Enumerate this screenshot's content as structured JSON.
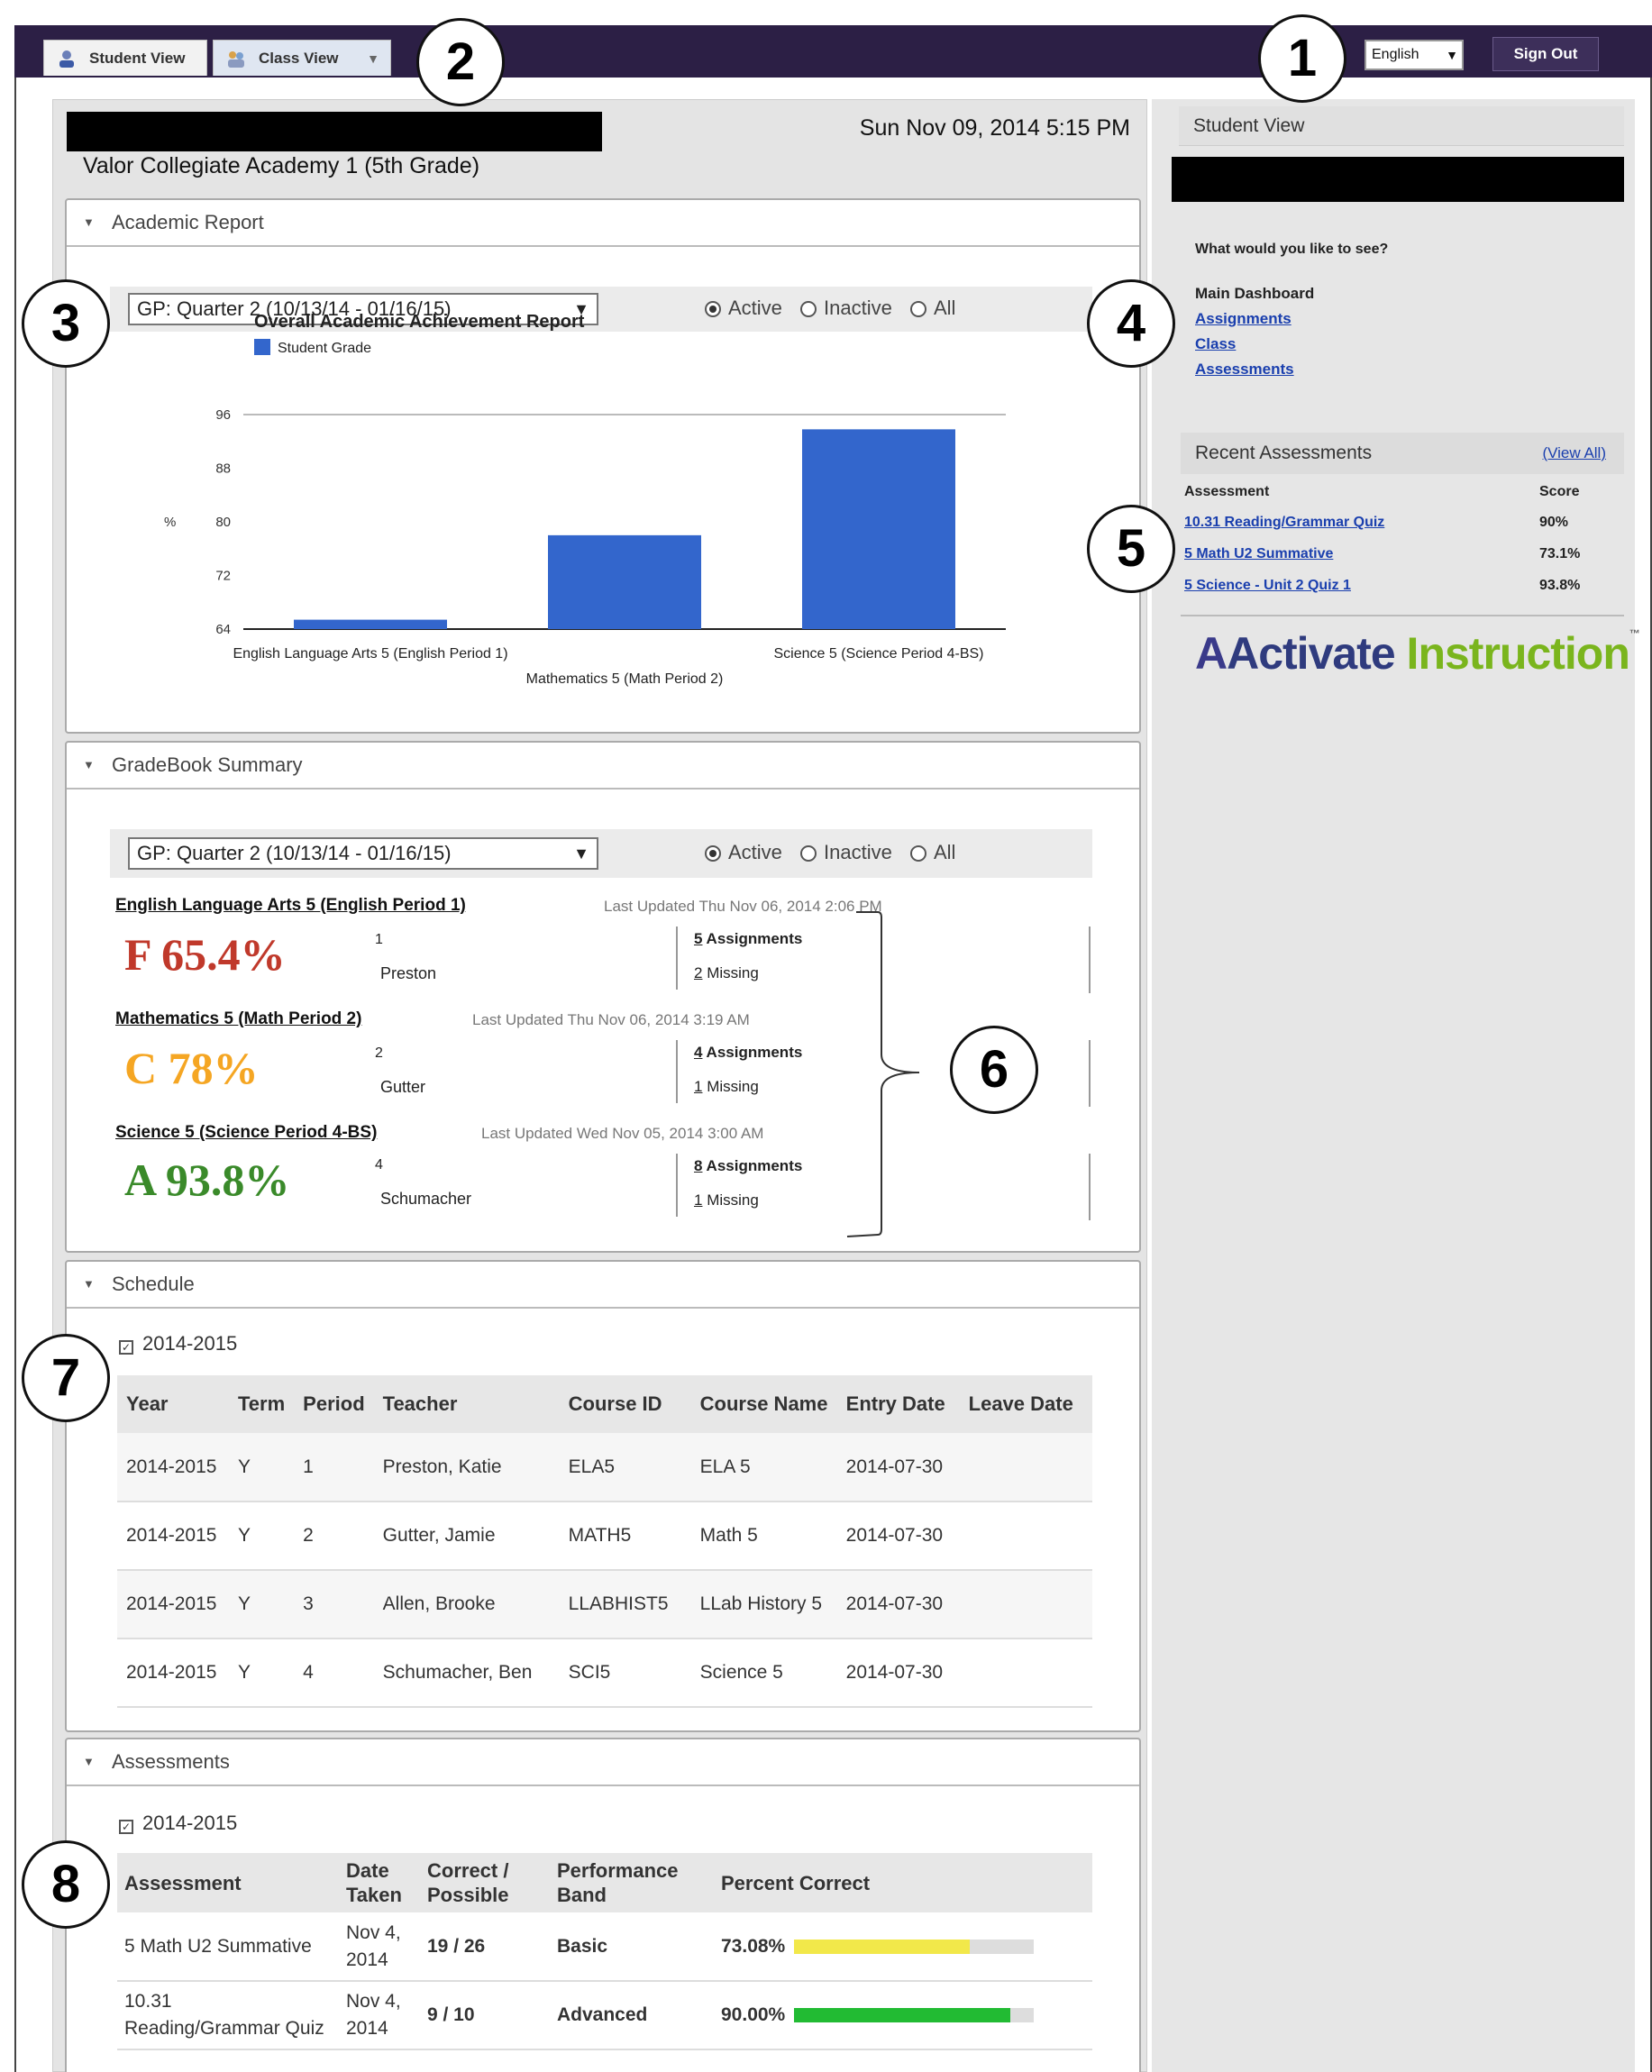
{
  "topbar": {
    "tabs": [
      {
        "label": "Student View"
      },
      {
        "label": "Class View"
      }
    ],
    "language": "English",
    "sign_out": "Sign Out"
  },
  "callouts": [
    "1",
    "2",
    "3",
    "4",
    "5",
    "6",
    "7",
    "8"
  ],
  "header": {
    "datetime": "Sun Nov 09, 2014 5:15 PM",
    "school": "Valor Collegiate Academy 1 (5th Grade)"
  },
  "academic_report": {
    "title": "Academic Report",
    "grading_period": "GP: Quarter 2 (10/13/14 - 01/16/15)",
    "filters": [
      "Active",
      "Inactive",
      "All"
    ],
    "selected_filter": "Active"
  },
  "chart_data": {
    "type": "bar",
    "title": "Overall Academic Achievement Report",
    "legend": [
      "Student Grade"
    ],
    "ylabel": "%",
    "ylim": [
      64,
      96
    ],
    "yticks": [
      64,
      72,
      80,
      88,
      96
    ],
    "categories": [
      "English Language Arts 5 (English Period 1)",
      "Mathematics 5 (Math Period 2)",
      "Science 5 (Science Period 4-BS)"
    ],
    "series": [
      {
        "name": "Student Grade",
        "values": [
          65.4,
          78,
          93.8
        ]
      }
    ],
    "bar_color": "#3366cc",
    "grid": false
  },
  "gradebook": {
    "title": "GradeBook Summary",
    "grading_period": "GP: Quarter 2 (10/13/14 - 01/16/15)",
    "filters": [
      "Active",
      "Inactive",
      "All"
    ],
    "courses": [
      {
        "name": "English Language Arts 5 (English Period 1)",
        "updated": "Last Updated Thu Nov 06, 2014 2:06 PM",
        "grade": "F 65.4%",
        "color": "#c0392b",
        "period": "1",
        "teacher": "Preston",
        "assignments_count": "5",
        "assignments_label": " Assignments",
        "missing_count": "2",
        "missing_label": " Missing"
      },
      {
        "name": "Mathematics 5 (Math Period 2)",
        "updated": "Last Updated Thu Nov 06, 2014 3:19 AM",
        "grade": "C 78%",
        "color": "#f5a623",
        "period": "2",
        "teacher": "Gutter",
        "assignments_count": "4",
        "assignments_label": " Assignments",
        "missing_count": "1",
        "missing_label": " Missing"
      },
      {
        "name": "Science 5 (Science Period 4-BS)",
        "updated": "Last Updated Wed Nov 05, 2014 3:00 AM",
        "grade": "A 93.8%",
        "color": "#3a8a2a",
        "period": "4",
        "teacher": "Schumacher",
        "assignments_count": "8",
        "assignments_label": " Assignments",
        "missing_count": "1",
        "missing_label": " Missing"
      }
    ]
  },
  "schedule": {
    "title": "Schedule",
    "year": "2014-2015",
    "columns": [
      "Year",
      "Term",
      "Period",
      "Teacher",
      "Course ID",
      "Course Name",
      "Entry Date",
      "Leave Date"
    ],
    "rows": [
      [
        "2014-2015",
        "Y",
        "1",
        "Preston, Katie",
        "ELA5",
        "ELA 5",
        "2014-07-30",
        ""
      ],
      [
        "2014-2015",
        "Y",
        "2",
        "Gutter, Jamie",
        "MATH5",
        "Math 5",
        "2014-07-30",
        ""
      ],
      [
        "2014-2015",
        "Y",
        "3",
        "Allen, Brooke",
        "LLABHIST5",
        "LLab History 5",
        "2014-07-30",
        ""
      ],
      [
        "2014-2015",
        "Y",
        "4",
        "Schumacher, Ben",
        "SCI5",
        "Science 5",
        "2014-07-30",
        ""
      ]
    ]
  },
  "assessments": {
    "title": "Assessments",
    "year": "2014-2015",
    "columns": [
      "Assessment",
      "Date Taken",
      "Correct / Possible",
      "Performance Band",
      "Percent Correct"
    ],
    "rows": [
      {
        "name": "5 Math U2 Summative",
        "date": "Nov 4, 2014",
        "correct": "19 / 26",
        "band": "Basic",
        "percent": "73.08%",
        "fraction": 0.7308,
        "color": "#f2e84a"
      },
      {
        "name": "10.31 Reading/Grammar Quiz",
        "date": "Nov 4, 2014",
        "correct": "9 / 10",
        "band": "Advanced",
        "percent": "90.00%",
        "fraction": 0.9,
        "color": "#22bb33"
      }
    ]
  },
  "sidebar": {
    "title": "Student View",
    "question": "What would you like to see?",
    "main_dashboard": "Main Dashboard",
    "links": [
      "Assignments",
      "Class",
      "Assessments"
    ],
    "recent": {
      "title": "Recent Assessments",
      "view_all": "(View All)",
      "col_assessment": "Assessment",
      "col_score": "Score",
      "items": [
        {
          "name": "10.31 Reading/Grammar Quiz",
          "score": "90%"
        },
        {
          "name": "5 Math U2 Summative",
          "score": "73.1%"
        },
        {
          "name": "5 Science - Unit 2 Quiz 1",
          "score": "93.8%"
        }
      ]
    },
    "logo": {
      "part1": "A",
      "part2": "Activate ",
      "part3": "Instruction",
      "tm": "™"
    }
  }
}
